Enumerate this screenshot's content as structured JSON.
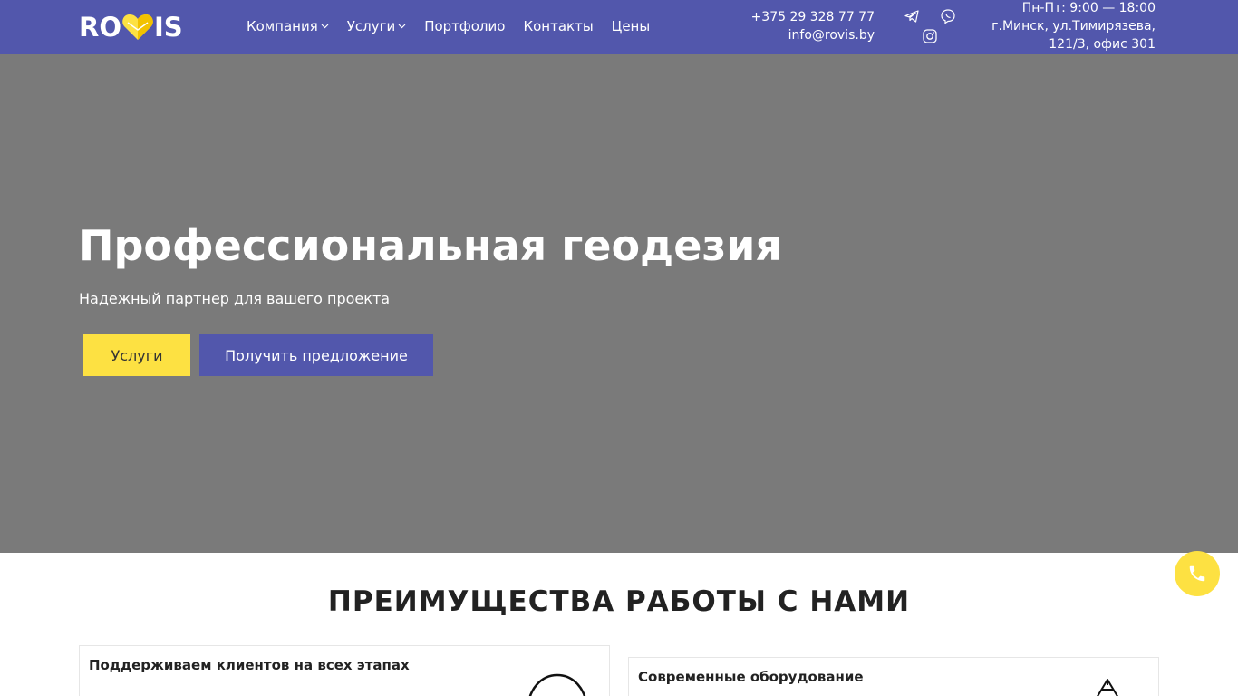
{
  "header": {
    "logo_left": "RO",
    "logo_right": "IS",
    "nav": [
      {
        "label": "Компания",
        "has_dropdown": true
      },
      {
        "label": "Услуги",
        "has_dropdown": true
      },
      {
        "label": "Портфолио",
        "has_dropdown": false
      },
      {
        "label": "Контакты",
        "has_dropdown": false
      },
      {
        "label": "Цены",
        "has_dropdown": false
      }
    ],
    "phone": "+375 29 328 77 77",
    "email": "info@rovis.by",
    "social_icons": [
      "telegram-icon",
      "viber-icon",
      "instagram-icon"
    ],
    "hours": "Пн-Пт: 9:00 — 18:00",
    "address_line1": "г.Минск, ул.Тимирязева,",
    "address_line2": "121/3, офис 301"
  },
  "hero": {
    "title": "Профессиональная геодезия",
    "subtitle": "Надежный партнер для вашего проекта",
    "btn_services": "Услуги",
    "btn_offer": "Получить предложение"
  },
  "advantages": {
    "title": "ПРЕИМУЩЕСТВА РАБОТЫ С НАМИ",
    "cards": [
      {
        "title": "Поддерживаем клиентов на всех этапах",
        "icon": "support-icon"
      },
      {
        "title": "Современные оборудование",
        "icon": "equipment-icon"
      }
    ]
  },
  "floating": {
    "icon": "phone-icon"
  },
  "colors": {
    "brand": "#5257ac",
    "accent": "#fde142",
    "hero_bg": "#7a7a7a"
  }
}
